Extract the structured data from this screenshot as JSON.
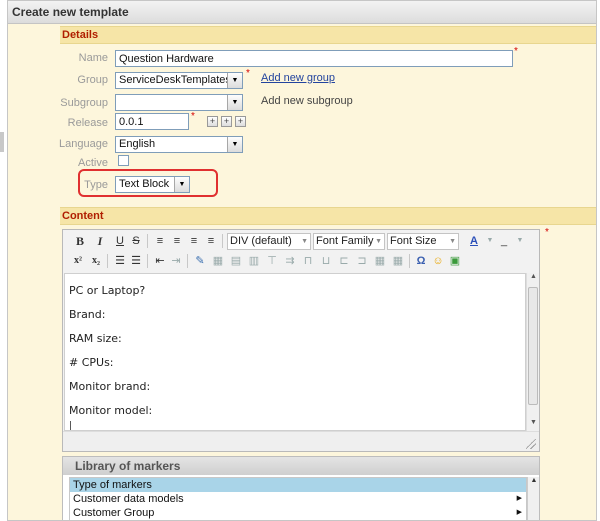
{
  "panel": {
    "title": "Create new template"
  },
  "details": {
    "section_title": "Details",
    "name": {
      "label": "Name",
      "value": "Question Hardware"
    },
    "group": {
      "label": "Group",
      "value": "ServiceDeskTemplates",
      "link": "Add new group"
    },
    "subgroup": {
      "label": "Subgroup",
      "value": "",
      "link": "Add new subgroup"
    },
    "release": {
      "label": "Release",
      "value": "0.0.1",
      "buttons": [
        "+",
        "+",
        "+"
      ]
    },
    "language": {
      "label": "Language",
      "value": "English"
    },
    "active": {
      "label": "Active",
      "checked": false
    },
    "type": {
      "label": "Type",
      "value": "Text Block"
    },
    "required_mark": "*"
  },
  "content": {
    "section_title": "Content",
    "toolbar": {
      "bold": "B",
      "italic": "I",
      "underline": "U",
      "strike": "S",
      "format": "DIV (default)",
      "font_family": "Font Family",
      "font_size": "Font Size",
      "sup": "x²",
      "sub": "x₂",
      "omega": "Ω"
    },
    "lines": [
      "PC or Laptop?",
      "Brand:",
      "RAM size:",
      "# CPUs:",
      "Monitor brand:",
      "Monitor model:",
      "|"
    ]
  },
  "library": {
    "title": "Library of markers",
    "items": [
      {
        "label": "Type of markers",
        "selected": true,
        "has_children": false
      },
      {
        "label": "Customer data models",
        "selected": false,
        "has_children": true
      },
      {
        "label": "Customer Group",
        "selected": false,
        "has_children": true
      }
    ]
  }
}
